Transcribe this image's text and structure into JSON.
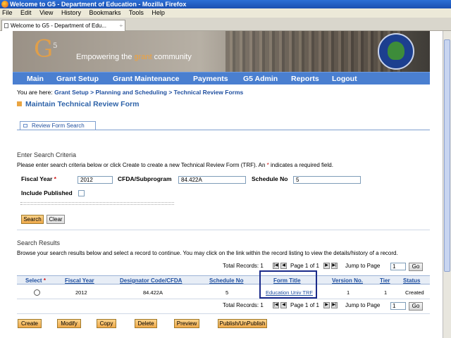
{
  "window": {
    "title": "Welcome to G5 - Department of Education - Mozilla Firefox"
  },
  "menu": [
    "File",
    "Edit",
    "View",
    "History",
    "Bookmarks",
    "Tools",
    "Help"
  ],
  "browser_tab": {
    "label": "Welcome to G5 - Department of Edu...",
    "close": "÷"
  },
  "banner": {
    "logo": "G",
    "logo_sup": "5",
    "slogan_pre": "Empowering the ",
    "slogan_grant": "grant",
    "slogan_post": " community"
  },
  "nav": [
    "Main",
    "Grant Setup",
    "Grant Maintenance",
    "Payments",
    "G5 Admin",
    "Reports",
    "Logout"
  ],
  "breadcrumb": {
    "prefix": "You are here: ",
    "items": [
      "Grant Setup",
      "Planning and Scheduling",
      "Technical Review Forms"
    ],
    "sep": " > "
  },
  "page_title": "Maintain Technical Review Form",
  "form_tab": "Review Form Search",
  "criteria": {
    "heading": "Enter Search Criteria",
    "hint_pre": "Please enter search criteria below or click Create to create a new Technical Review Form (TRF). An ",
    "hint_star": "*",
    "hint_post": " indicates a required field.",
    "fiscal_year_label": "Fiscal Year",
    "fiscal_year_value": "2012",
    "cfda_label": "CFDA/Subprogram",
    "cfda_value": "84.422A",
    "schedule_label": "Schedule No",
    "schedule_value": "5",
    "include_published_label": "Include Published",
    "search_button": "Search",
    "clear_button": "Clear"
  },
  "results": {
    "heading": "Search Results",
    "hint": "Browse your search results below and select a record to continue. You may click on the link within the record listing to view the details/history of a record.",
    "total_label": "Total Records: 1",
    "page_label": "Page 1 of 1",
    "jump_label": "Jump to Page",
    "jump_value": "1",
    "go_button": "Go",
    "columns": [
      "Select",
      "Fiscal Year",
      "Designator Code/CFDA",
      "Schedule No",
      "Form Title",
      "Version No.",
      "Tier",
      "Status"
    ],
    "rows": [
      {
        "fiscal_year": "2012",
        "designator": "84.422A",
        "schedule": "5",
        "form_title": "Education Univ TRF",
        "version": "1",
        "tier": "1",
        "status": "Created"
      }
    ]
  },
  "actions": [
    "Create",
    "Modify",
    "Copy",
    "Delete",
    "Preview",
    "Publish/UnPublish"
  ]
}
